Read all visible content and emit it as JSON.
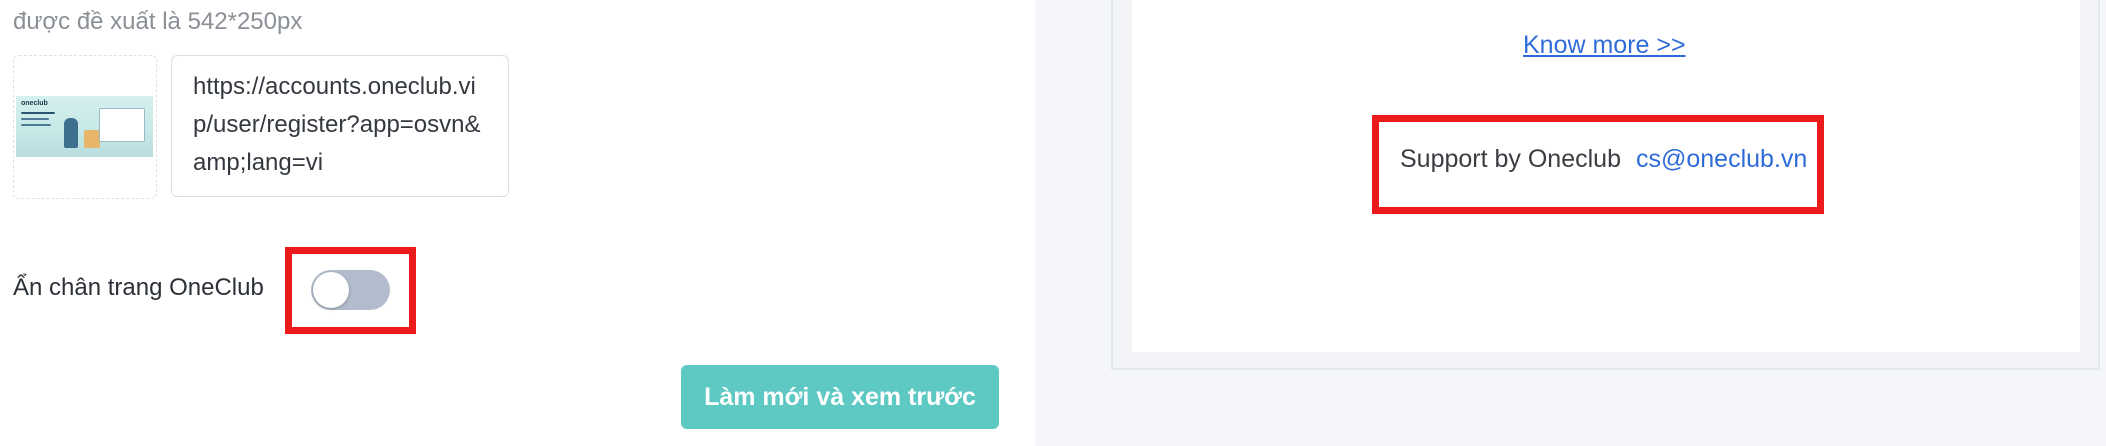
{
  "settings": {
    "hint": "được đề xuất là 542*250px",
    "banner_thumbnail": {
      "logo_text": "oneclub"
    },
    "link_url": "https://accounts.oneclub.vip/user/register?app=osvn&amp;lang=vi",
    "hide_footer": {
      "label": "Ẩn chân trang OneClub",
      "enabled": false
    },
    "refresh_button_label": "Làm mới và xem trước"
  },
  "preview": {
    "know_more_label": "Know more >>",
    "support_label": "Support by Oneclub",
    "support_email": "cs@oneclub.vn"
  },
  "colors": {
    "accent": "#5ec8c3",
    "link": "#2f6cd9",
    "highlight": "#ec1b1b",
    "toggle_off": "#b2bccc"
  }
}
